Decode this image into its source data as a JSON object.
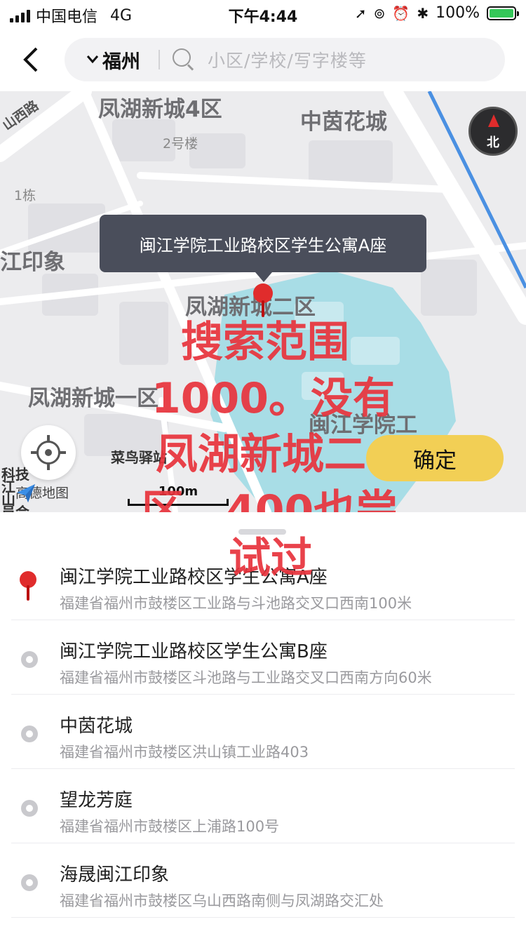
{
  "status_bar": {
    "carrier": "中国电信",
    "network": "4G",
    "time": "下午4:44",
    "battery": "100%"
  },
  "header": {
    "city": "福州",
    "search_placeholder": "小区/学校/写字楼等"
  },
  "map": {
    "labels": {
      "area4": "凤湖新城4区",
      "zhongyin": "中茵花城",
      "bldg2": "2号楼",
      "bldg1": "1栋",
      "yinxiang": "江印象",
      "area2": "凤湖新城二区",
      "area1": "凤湖新城一区",
      "minjiang": "闽江学院工",
      "cainiao": "菜鸟驿站",
      "wushan": "山西路",
      "keji": "科技",
      "jiang": "江",
      "shan": "山",
      "yuan": "员会"
    },
    "tooltip": "闽江学院工业路校区学生公寓A座",
    "compass": "北",
    "confirm": "确定",
    "logo": "高德地图",
    "scale": "100m",
    "annotation_lines": [
      "搜索范围",
      "1000。没有",
      "凤湖新城二",
      "区。400也尝",
      "试过"
    ],
    "colors": {
      "water": "#a8dde6",
      "pin": "#e02c2c",
      "confirm": "#f2cf55"
    }
  },
  "results": [
    {
      "title": "闽江学院工业路校区学生公寓A座",
      "address": "福建省福州市鼓楼区工业路与斗池路交叉口西南100米",
      "icon": "location-pin-icon"
    },
    {
      "title": "闽江学院工业路校区学生公寓B座",
      "address": "福建省福州市鼓楼区斗池路与工业路交叉口西南方向60米",
      "icon": "radio-dot-icon"
    },
    {
      "title": "中茵花城",
      "address": "福建省福州市鼓楼区洪山镇工业路403",
      "icon": "radio-dot-icon"
    },
    {
      "title": "望龙芳庭",
      "address": "福建省福州市鼓楼区上浦路100号",
      "icon": "radio-dot-icon"
    },
    {
      "title": "海晟闽江印象",
      "address": "福建省福州市鼓楼区乌山西路南侧与凤湖路交汇处",
      "icon": "radio-dot-icon"
    }
  ]
}
